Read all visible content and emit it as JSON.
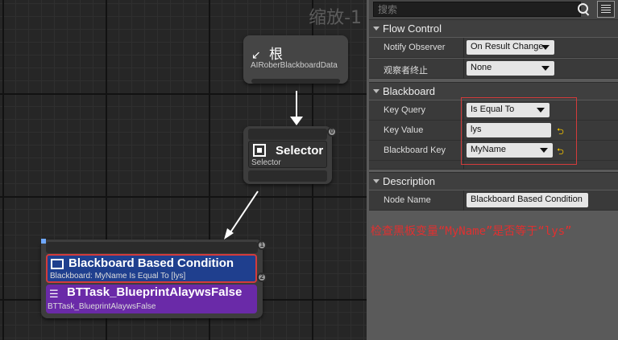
{
  "graph": {
    "zoom_label": "缩放-1",
    "root_node": {
      "title": "根",
      "subtitle": "AIRoberBlackboardData"
    },
    "selector_node": {
      "title": "Selector",
      "subtitle": "Selector",
      "pin_index": "0"
    },
    "task_node": {
      "decorator": {
        "title": "Blackboard Based Condition",
        "subtitle": "Blackboard: MyName Is Equal To [lys]",
        "pin_index": "1"
      },
      "task": {
        "title": "BTTask_BlueprintAlaywsFalse",
        "subtitle": "BTTask_BlueprintAlaywsFalse",
        "pin_index": "2"
      }
    }
  },
  "details": {
    "search": {
      "placeholder": "搜索"
    },
    "sections": {
      "flow_control": {
        "title": "Flow Control",
        "notify_observer": {
          "label": "Notify Observer",
          "value": "On Result Change"
        },
        "observer_aborts": {
          "label": "观察者终止",
          "value": "None"
        }
      },
      "blackboard": {
        "title": "Blackboard",
        "key_query": {
          "label": "Key Query",
          "value": "Is Equal To"
        },
        "key_value": {
          "label": "Key Value",
          "value": "lys"
        },
        "blackboard_key": {
          "label": "Blackboard Key",
          "value": "MyName"
        }
      },
      "description": {
        "title": "Description",
        "node_name": {
          "label": "Node Name",
          "value": "Blackboard Based Condition"
        }
      }
    },
    "annotation": "检查黑板变量“MyName”是否等于“lys”"
  },
  "colors": {
    "decorator_blue": "#1f3f8e",
    "task_purple": "#6a2aa8",
    "highlight_red": "#d43b3b",
    "annotation_red": "#e03030"
  }
}
